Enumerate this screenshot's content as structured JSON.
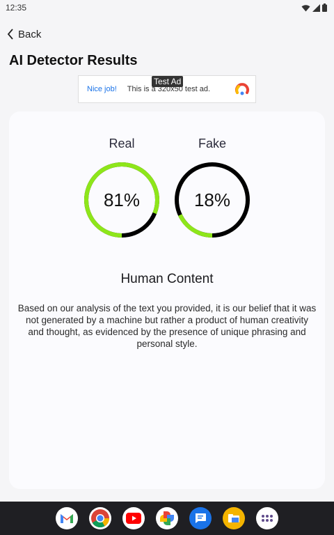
{
  "status_bar": {
    "time": "12:35"
  },
  "header": {
    "back_label": "Back",
    "title": "AI Detector Results"
  },
  "ad": {
    "tag": "Test Ad",
    "cta": "Nice job!",
    "text": "This is a 320x50 test ad."
  },
  "scores": [
    {
      "label": "Real",
      "value_text": "81%",
      "value": 81,
      "color": "#8ee61a"
    },
    {
      "label": "Fake",
      "value_text": "18%",
      "value": 18,
      "color": "#8ee61a"
    }
  ],
  "result": {
    "verdict": "Human Content",
    "explanation": "Based on our analysis of the text you provided, it is our belief that it was not generated by a machine but rather a product of human creativity and thought, as evidenced by the presence of unique phrasing and personal style."
  },
  "dock": {
    "apps": [
      "gmail-icon",
      "chrome-icon",
      "youtube-icon",
      "photos-icon",
      "messages-icon",
      "files-icon",
      "app-drawer-icon"
    ]
  },
  "colors": {
    "ring_fill": "#8ee61a",
    "ring_track": "#000000",
    "card_bg": "#fbfbfe",
    "page_bg": "#f5f5f7",
    "nav_bg": "#1f1f23"
  }
}
